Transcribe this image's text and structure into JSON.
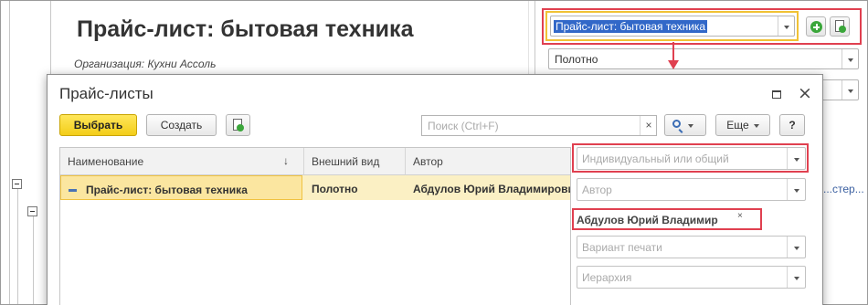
{
  "report": {
    "title": "Прайс-лист: бытовая техника",
    "organization": "Организация: Кухни Ассоль",
    "settings_link": "...стер...",
    "price_list_combo_value": "Прайс-лист: бытовая техника",
    "appearance_combo_value": "Полотно"
  },
  "dialog": {
    "title": "Прайс-листы",
    "toolbar": {
      "select_label": "Выбрать",
      "create_label": "Создать",
      "search_placeholder": "Поиск (Ctrl+F)",
      "search_clear": "×",
      "more_label": "Еще",
      "help_label": "?"
    },
    "table": {
      "columns": [
        "Наименование",
        "Внешний вид",
        "Автор"
      ],
      "sort_indicator": "↓",
      "rows": [
        {
          "name": "Прайс-лист: бытовая техника",
          "appearance": "Полотно",
          "author": "Абдулов Юрий Владимирович"
        }
      ]
    },
    "filters": {
      "individual_or_shared_placeholder": "Индивидуальный или общий",
      "author_placeholder": "Автор",
      "author_tag": "Абдулов Юрий Владимир",
      "author_tag_remove": "×",
      "print_variant_placeholder": "Вариант печати",
      "hierarchy_placeholder": "Иерархия"
    }
  },
  "colors": {
    "highlight_red": "#e04050",
    "highlight_yellow": "#f1c235",
    "primary_button": "#f5d327",
    "selected_row": "#fbf0c4"
  }
}
